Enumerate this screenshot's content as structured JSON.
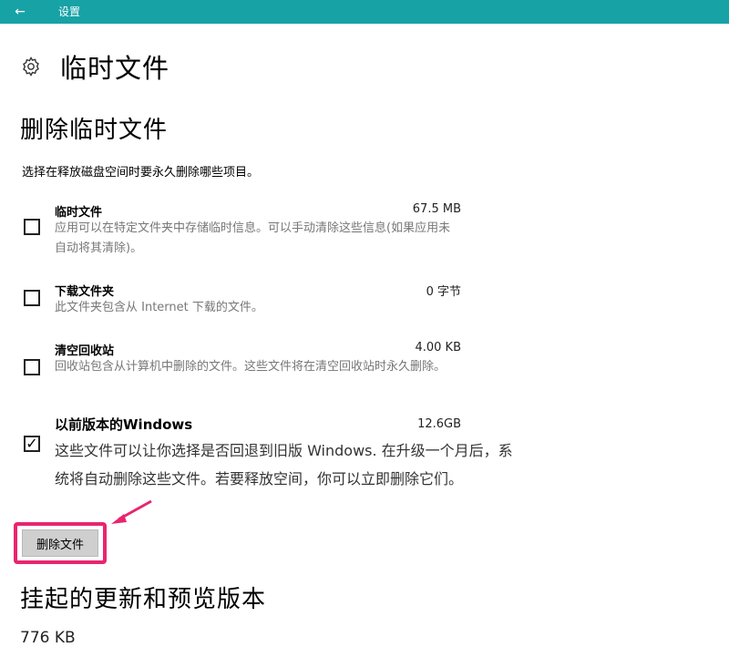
{
  "titlebar": {
    "back_icon": "back-arrow-icon",
    "title": "设置"
  },
  "page": {
    "icon": "gear-icon",
    "title": "临时文件"
  },
  "section": {
    "title": "删除临时文件",
    "description": "选择在释放磁盘空间时要永久删除哪些项目。"
  },
  "items": [
    {
      "name": "临时文件",
      "size": "67.5 MB",
      "info": "应用可以在特定文件夹中存储临时信息。可以手动清除这些信息(如果应用未自动将其清除)。",
      "checked": false
    },
    {
      "name": "下载文件夹",
      "size": "0 字节",
      "info": "此文件夹包含从 Internet 下载的文件。",
      "checked": false
    },
    {
      "name": "清空回收站",
      "size": "4.00 KB",
      "info": "回收站包含从计算机中删除的文件。这些文件将在清空回收站时永久删除。",
      "checked": false
    },
    {
      "name": "以前版本的Windows",
      "size": "12.6GB",
      "info": "这些文件可以让你选择是否回退到旧版 Windows. 在升级一个月后，系统将自动删除这些文件。若要释放空间，你可以立即删除它们。",
      "checked": true,
      "check_mark": "✓"
    }
  ],
  "delete_button": {
    "label": "删除文件"
  },
  "colors": {
    "titlebar": "#17a2a6",
    "highlight": "#e8256f"
  },
  "pending": {
    "title": "挂起的更新和预览版本",
    "size": "776 KB"
  }
}
